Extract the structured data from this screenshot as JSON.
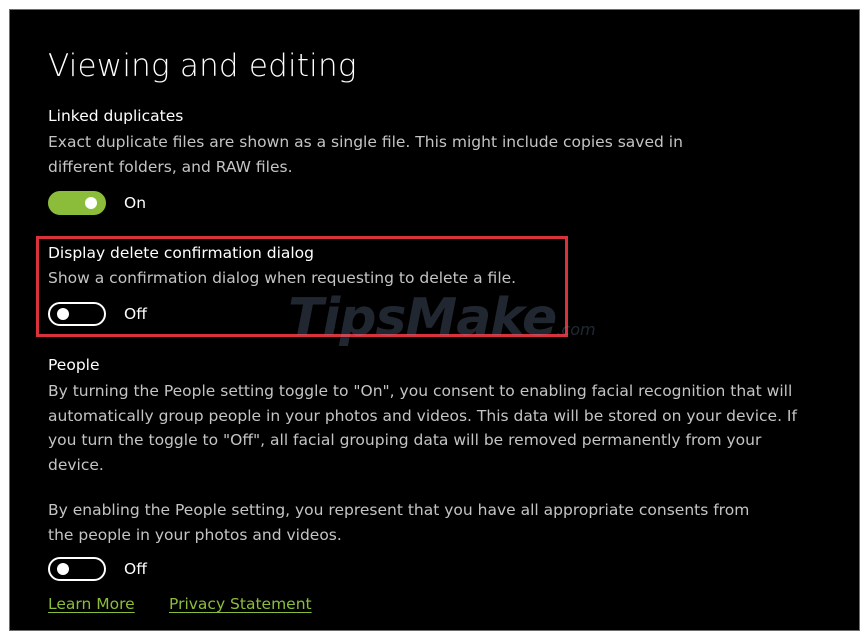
{
  "page": {
    "title": "Viewing and editing"
  },
  "linked_duplicates": {
    "label": "Linked duplicates",
    "description": "Exact duplicate files are shown as a single file. This might include copies saved in different folders, and RAW files.",
    "state": "On"
  },
  "delete_confirmation": {
    "label": "Display delete confirmation dialog",
    "description": "Show a confirmation dialog when requesting to delete a file.",
    "state": "Off"
  },
  "people": {
    "label": "People",
    "description": "By turning the People setting toggle to \"On\", you consent to enabling facial recognition that will automatically group people in your photos and videos. This data will be stored on your device. If you turn the toggle to \"Off\", all facial grouping data will be removed permanently from your device.",
    "consent": "By enabling the People setting, you represent that you have all appropriate consents from the people in your photos and videos.",
    "state": "Off"
  },
  "links": {
    "learn_more": "Learn More",
    "privacy_statement": "Privacy Statement"
  },
  "watermark": {
    "text": "TipsMake",
    "suffix": ".com"
  },
  "colors": {
    "accent": "#8cbd3a",
    "highlight": "#d9323b",
    "background": "#000000"
  }
}
